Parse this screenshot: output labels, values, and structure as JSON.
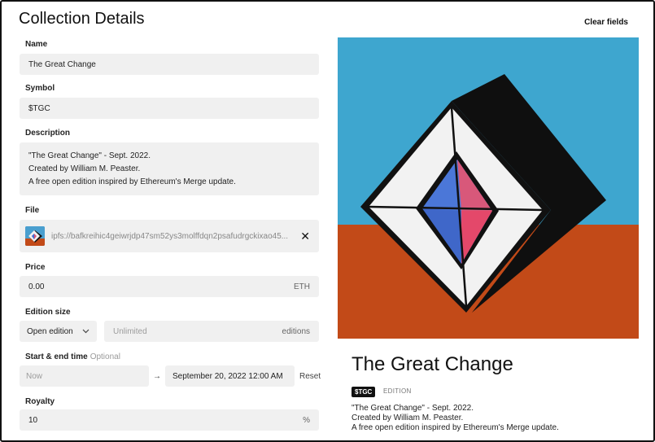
{
  "page": {
    "title": "Collection Details",
    "clear_label": "Clear fields"
  },
  "form": {
    "name": {
      "label": "Name",
      "value": "The Great Change"
    },
    "symbol": {
      "label": "Symbol",
      "value": "$TGC"
    },
    "description": {
      "label": "Description",
      "lines": [
        "\"The Great Change\" - Sept. 2022.",
        "Created by William M. Peaster.",
        "A free open edition inspired by Ethereum's Merge update."
      ]
    },
    "file": {
      "label": "File",
      "value": "ipfs://bafkreihic4geiwrjdp47sm52ys3molffdqn2psafudrgckixao45...",
      "thumb_icon": "artwork-thumbnail-icon",
      "remove_icon": "close-icon"
    },
    "price": {
      "label": "Price",
      "value": "0.00",
      "unit": "ETH"
    },
    "edition_size": {
      "label": "Edition size",
      "selected": "Open edition",
      "placeholder": "Unlimited",
      "unit": "editions"
    },
    "dates": {
      "label": "Start & end time",
      "optional": "Optional",
      "start_placeholder": "Now",
      "arrow": "→",
      "end_value": "September 20, 2022 12:00 AM",
      "reset_label": "Reset"
    },
    "royalty": {
      "label": "Royalty",
      "value": "10",
      "unit": "%"
    }
  },
  "preview": {
    "title": "The Great Change",
    "symbol_badge": "$TGC",
    "edition_tag": "EDITION",
    "description_lines": [
      "\"The Great Change\" - Sept. 2022.",
      "Created by William M. Peaster.",
      "A free open edition inspired by Ethereum's Merge update."
    ],
    "colors": {
      "sky": "#3ea6cf",
      "ground": "#c24a18",
      "shadow": "#0f0f0f",
      "blue": "#3b6fd6",
      "pink": "#e4486a"
    }
  }
}
